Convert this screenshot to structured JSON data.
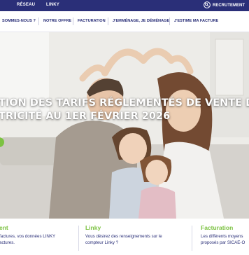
{
  "topbar": {
    "links": [
      "RÉSEAU",
      "LINKY"
    ],
    "recruit_label": "RECRUTEMENT",
    "recruit_icon": "recruitment-icon"
  },
  "nav": {
    "items": [
      "SOMMES-NOUS ?",
      "NOTRE OFFRE",
      "FACTURATION",
      "J'EMMÉNAGE, JE DÉMÉNAGE",
      "J'ESTIME MA FACTURE"
    ]
  },
  "hero": {
    "headline_line1": "TION DES TARIFS RÉGLEMENTÉS DE VENTE DE",
    "headline_line2": "TRICITÉ AU 1ER FÉVRIER 2026",
    "accent_color": "#7cc242"
  },
  "cards": [
    {
      "title": "ent",
      "text_line1": "factures, vos données LINKY",
      "text_line2": "actures."
    },
    {
      "title": "Linky",
      "text_line1": "Vous désirez des renseignements sur le",
      "text_line2": "compteur Linky ?"
    },
    {
      "title": "Facturation",
      "text_line1": "Les différents moyens",
      "text_line2": "proposés par SICAE-O"
    }
  ],
  "colors": {
    "navy": "#2a2f78",
    "green": "#7cc242"
  }
}
